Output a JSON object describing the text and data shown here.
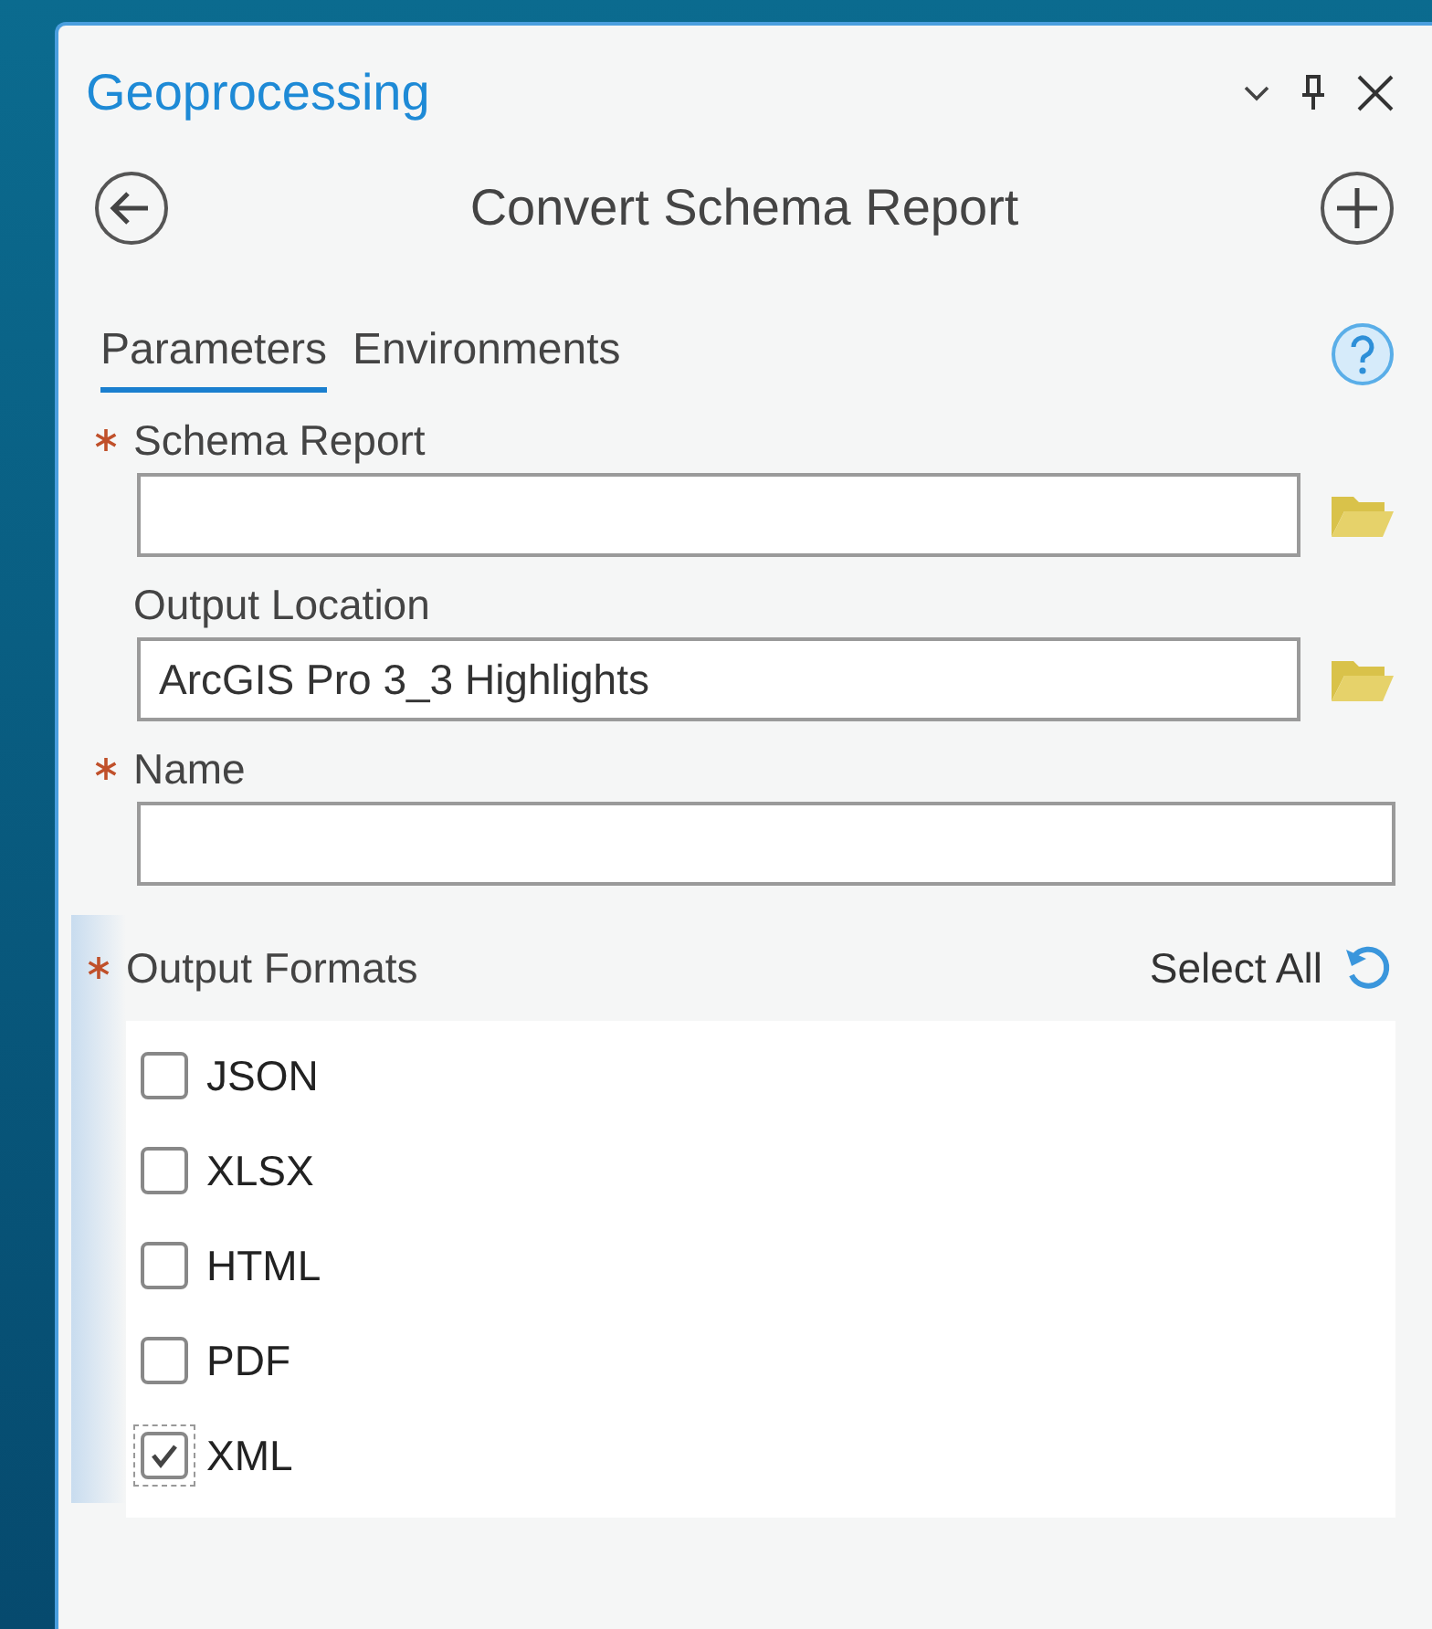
{
  "pane": {
    "title": "Geoprocessing"
  },
  "tool": {
    "title": "Convert Schema Report"
  },
  "tabs": [
    {
      "label": "Parameters",
      "selected": true
    },
    {
      "label": "Environments",
      "selected": false
    }
  ],
  "parameters": [
    {
      "label": "Schema Report",
      "required": true,
      "browse": true
    },
    {
      "label": "Output Location",
      "required": false,
      "browse": true,
      "value": "ArcGIS Pro 3_3 Highlights"
    },
    {
      "label": "Name",
      "required": true,
      "browse": false
    }
  ],
  "output_formats": {
    "label": "Output Formats",
    "required": true,
    "select_all": "Select All",
    "options": [
      {
        "label": "JSON",
        "checked": false,
        "focused": false
      },
      {
        "label": "XLSX",
        "checked": false,
        "focused": false
      },
      {
        "label": "HTML",
        "checked": false,
        "focused": false
      },
      {
        "label": "PDF",
        "checked": false,
        "focused": false
      },
      {
        "label": "XML",
        "checked": true,
        "focused": true
      }
    ]
  }
}
